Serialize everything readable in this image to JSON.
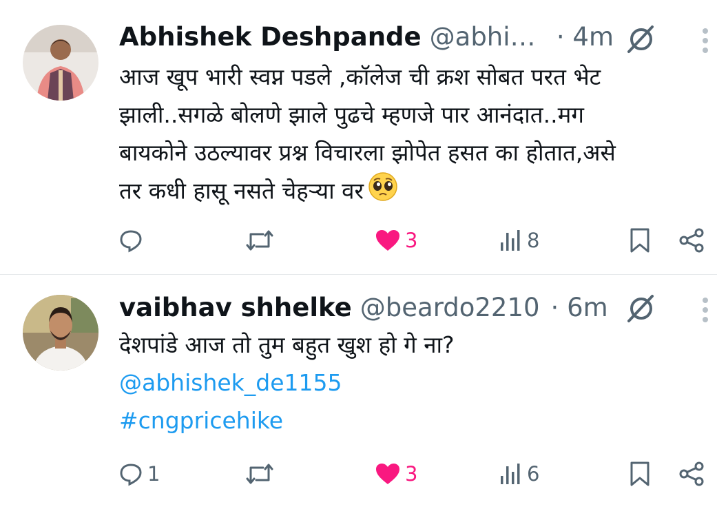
{
  "tweets": [
    {
      "name": "Abhishek Deshpande",
      "handle": "@abhis…",
      "time": "· 4m",
      "lines": [
        "आज खूप भारी स्वप्न पडले ,कॉलेज ची क्रश सोबत परत भेट",
        "झाली..सगळे बोलणे झाले पुढचे म्हणजे पार आनंदात..मग",
        "बायकोने उठल्यावर प्रश्न विचारला झोपेत हसत का होतात,असे",
        "तर कधी हासू नसते चेहऱ्या वर"
      ],
      "emoji": "pleading-face-icon",
      "reply_count": "",
      "like_count": "3",
      "view_count": "8"
    },
    {
      "name": "vaibhav shhelke",
      "handle": "@beardo2210",
      "time": "· 6m",
      "lines": [
        "देशपांडे आज तो तुम बहुत खुश हो गे ना?"
      ],
      "mention": "@abhishek_de1155",
      "hashtag": "#cngpricehike",
      "reply_count": "1",
      "like_count": "3",
      "view_count": "6"
    }
  ],
  "colors": {
    "like": "#f91880",
    "link": "#1d9bf0",
    "muted": "#536471",
    "text": "#0f1419"
  }
}
